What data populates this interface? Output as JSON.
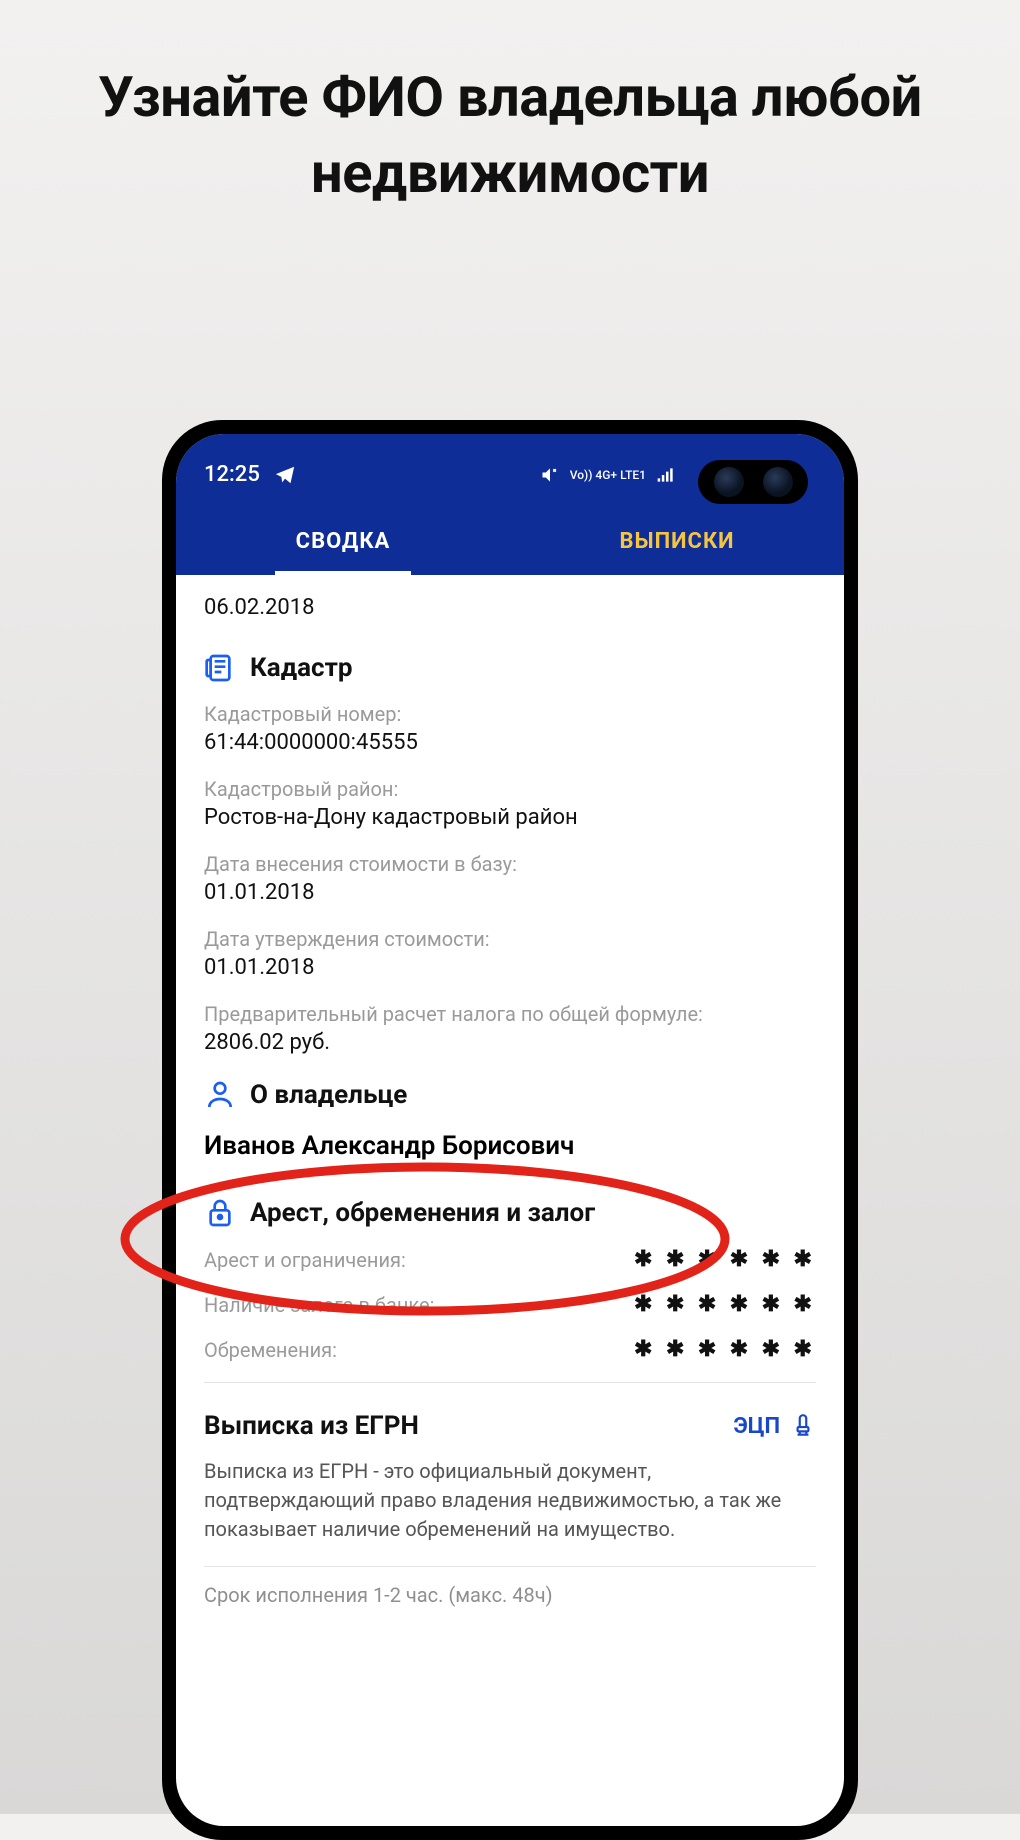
{
  "promo": {
    "headline": "Узнайте ФИО владельца любой недвижимости"
  },
  "statusbar": {
    "time": "12:25",
    "network_label": "Vo)) 4G+ LTE1"
  },
  "tabs": {
    "summary": "СВОДКА",
    "extracts": "ВЫПИСКИ"
  },
  "top_date": "06.02.2018",
  "cadastre": {
    "section_title": "Кадастр",
    "number_label": "Кадастровый номер:",
    "number_value": "61:44:0000000:45555",
    "district_label": "Кадастровый район:",
    "district_value": "Ростов-на-Дону  кадастровый район",
    "cost_entry_label": "Дата внесения стоимости в базу:",
    "cost_entry_value": "01.01.2018",
    "cost_approve_label": "Дата утверждения стоимости:",
    "cost_approve_value": "01.01.2018",
    "tax_label": "Предварительный расчет налога по общей формуле:",
    "tax_value": "2806.02 руб."
  },
  "owner": {
    "section_title": "О владельце",
    "full_name": "Иванов Александр Борисович"
  },
  "liens": {
    "section_title": "Арест, обременения и залог",
    "arrest_label": "Арест и ограничения:",
    "pledge_label": "Наличие залога в банке:",
    "encumb_label": "Обременения:",
    "masked": "✱ ✱ ✱ ✱ ✱ ✱"
  },
  "egrn": {
    "title": "Выписка из ЕГРН",
    "badge": "ЭЦП",
    "description": "Выписка из ЕГРН - это официальный документ, подтверждающий право владения недвижимостью, а так же показывает наличие обременений на имущество.",
    "time_hint": "Срок исполнения 1-2 час. (макс. 48ч)"
  }
}
